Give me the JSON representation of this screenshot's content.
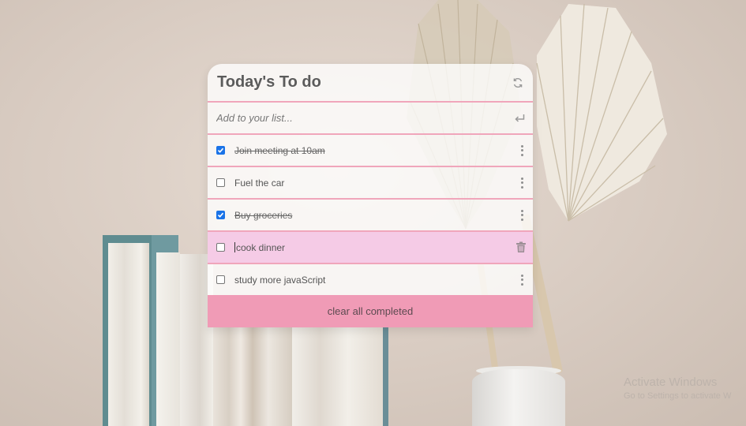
{
  "card": {
    "title": "Today's To do",
    "refresh_icon": "refresh-icon",
    "add_placeholder": "Add to your list...",
    "enter_icon": "enter-icon",
    "todos": [
      {
        "text": "Join meeting at 10am",
        "checked": true
      },
      {
        "text": "Fuel the car",
        "checked": false
      },
      {
        "text": "Buy groceries",
        "checked": true
      },
      {
        "text": "cook dinner",
        "checked": false,
        "editing": true
      },
      {
        "text": "study more javaScript",
        "checked": false
      }
    ],
    "clear_label": "clear all completed"
  },
  "watermark": {
    "line1": "Activate Windows",
    "line2": "Go to Settings to activate W"
  },
  "colors": {
    "accent_pink": "#f09bb6",
    "divider_pink": "#f0a6bb",
    "active_row": "#f5cbe6",
    "checkbox_blue": "#1a73e8"
  }
}
